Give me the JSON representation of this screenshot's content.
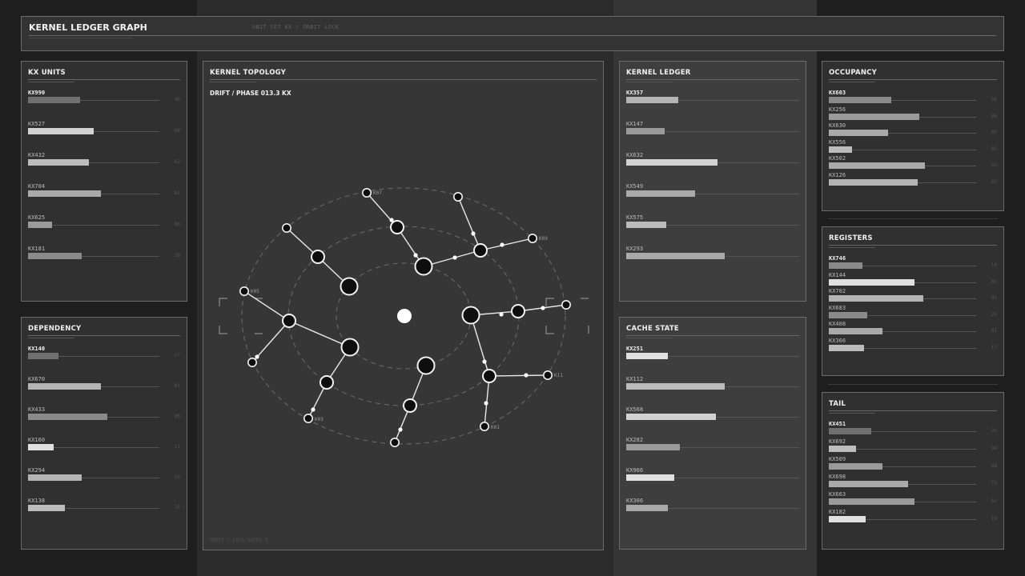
{
  "header": {
    "title": "KERNEL LEDGER GRAPH",
    "subtitle": "UNIT SET KX / ORBIT LOCK"
  },
  "kx_units": {
    "title": "KX UNITS",
    "rows": [
      {
        "label": "KX990",
        "value": "48",
        "pct": 0.34,
        "color": "#6f706f"
      },
      {
        "label": "KX527",
        "value": "88",
        "pct": 0.43,
        "color": "#d2d2d2"
      },
      {
        "label": "KX432",
        "value": "62",
        "pct": 0.4,
        "color": "#bcbcbc"
      },
      {
        "label": "KX704",
        "value": "81",
        "pct": 0.48,
        "color": "#a9a9a9"
      },
      {
        "label": "KX625",
        "value": "86",
        "pct": 0.16,
        "color": "#9a9a9a"
      },
      {
        "label": "KX181",
        "value": "38",
        "pct": 0.35,
        "color": "#8a8a8a"
      }
    ]
  },
  "dependency": {
    "title": "DEPENDENCY",
    "rows": [
      {
        "label": "KX140",
        "value": "57",
        "pct": 0.2,
        "color": "#6f706f"
      },
      {
        "label": "KX670",
        "value": "81",
        "pct": 0.48,
        "color": "#b4b4b4"
      },
      {
        "label": "KX433",
        "value": "96",
        "pct": 0.52,
        "color": "#8a8a8a"
      },
      {
        "label": "KX160",
        "value": "11",
        "pct": 0.17,
        "color": "#e0e0e0"
      },
      {
        "label": "KX294",
        "value": "58",
        "pct": 0.35,
        "color": "#b4b4b4"
      },
      {
        "label": "KX138",
        "value": "25",
        "pct": 0.24,
        "color": "#bcbcbc"
      }
    ]
  },
  "topology": {
    "title": "KERNEL TOPOLOGY",
    "drift": "DRIFT / PHASE 013.3 KX",
    "footer": "DRIFT / LOCK GATES 3",
    "tags": [
      "K07",
      "K09",
      "K05",
      "K03",
      "K01",
      "K11"
    ]
  },
  "kernel_ledger": {
    "title": "KERNEL LEDGER",
    "rows": [
      {
        "label": "KX357",
        "pct": 0.3,
        "color": "#b4b4b4"
      },
      {
        "label": "KX147",
        "pct": 0.22,
        "color": "#9a9a9a"
      },
      {
        "label": "KX632",
        "pct": 0.53,
        "color": "#d2d2d2"
      },
      {
        "label": "KX549",
        "pct": 0.4,
        "color": "#a9a9a9"
      },
      {
        "label": "KX575",
        "pct": 0.23,
        "color": "#bcbcbc"
      },
      {
        "label": "KX293",
        "pct": 0.57,
        "color": "#a9a9a9"
      }
    ]
  },
  "cache_state": {
    "title": "CACHE STATE",
    "rows": [
      {
        "label": "KX251",
        "pct": 0.24,
        "color": "#e0e0e0"
      },
      {
        "label": "KX112",
        "pct": 0.57,
        "color": "#bcbcbc"
      },
      {
        "label": "KX568",
        "pct": 0.52,
        "color": "#d2d2d2"
      },
      {
        "label": "KX282",
        "pct": 0.31,
        "color": "#9a9a9a"
      },
      {
        "label": "KX966",
        "pct": 0.28,
        "color": "#e0e0e0"
      },
      {
        "label": "KX366",
        "pct": 0.24,
        "color": "#a9a9a9"
      }
    ]
  },
  "occupancy": {
    "title": "OCCUPANCY",
    "rows": [
      {
        "label": "KX603",
        "value": "56",
        "pct": 0.37,
        "color": "#8a8a8a"
      },
      {
        "label": "KX256",
        "value": "86",
        "pct": 0.54,
        "color": "#9a9a9a"
      },
      {
        "label": "KX630",
        "value": "45",
        "pct": 0.35,
        "color": "#a9a9a9"
      },
      {
        "label": "KX556",
        "value": "85",
        "pct": 0.14,
        "color": "#bcbcbc"
      },
      {
        "label": "KX502",
        "value": "55",
        "pct": 0.57,
        "color": "#a9a9a9"
      },
      {
        "label": "KX126",
        "value": "65",
        "pct": 0.53,
        "color": "#b4b4b4"
      }
    ]
  },
  "registers": {
    "title": "REGISTERS",
    "rows": [
      {
        "label": "KX746",
        "value": "14",
        "pct": 0.2,
        "color": "#8a8a8a"
      },
      {
        "label": "KX144",
        "value": "85",
        "pct": 0.51,
        "color": "#e0e0e0"
      },
      {
        "label": "KX702",
        "value": "92",
        "pct": 0.56,
        "color": "#b4b4b4"
      },
      {
        "label": "KX683",
        "value": "25",
        "pct": 0.23,
        "color": "#8a8a8a"
      },
      {
        "label": "KX408",
        "value": "41",
        "pct": 0.32,
        "color": "#a9a9a9"
      },
      {
        "label": "KX366",
        "value": "17",
        "pct": 0.21,
        "color": "#bcbcbc"
      }
    ]
  },
  "tail": {
    "title": "TAIL",
    "rows": [
      {
        "label": "KX451",
        "value": "26",
        "pct": 0.25,
        "color": "#6f706f"
      },
      {
        "label": "KX692",
        "value": "94",
        "pct": 0.16,
        "color": "#bcbcbc"
      },
      {
        "label": "KX509",
        "value": "48",
        "pct": 0.32,
        "color": "#9a9a9a"
      },
      {
        "label": "KX698",
        "value": "73",
        "pct": 0.47,
        "color": "#a9a9a9"
      },
      {
        "label": "KX663",
        "value": "62",
        "pct": 0.51,
        "color": "#9a9a9a"
      },
      {
        "label": "KX182",
        "value": "19",
        "pct": 0.22,
        "color": "#e0e0e0"
      }
    ]
  }
}
